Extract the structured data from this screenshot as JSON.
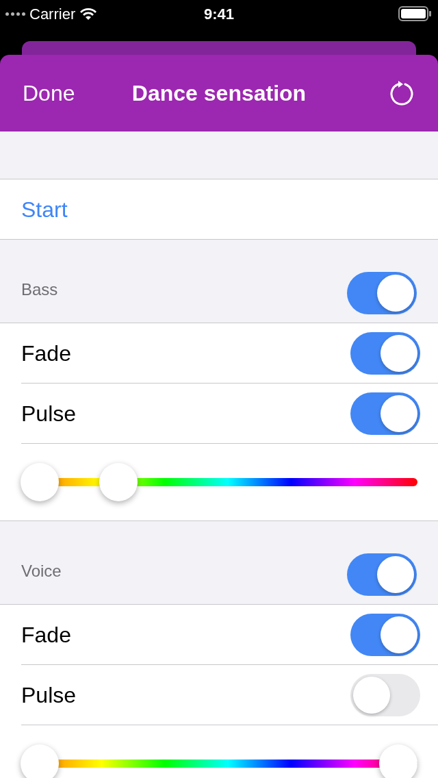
{
  "status_bar": {
    "carrier": "Carrier",
    "time": "9:41"
  },
  "nav": {
    "done": "Done",
    "title": "Dance sensation"
  },
  "start": "Start",
  "sections": [
    {
      "title": "Bass",
      "on": true,
      "rows": [
        {
          "label": "Fade",
          "on": true
        },
        {
          "label": "Pulse",
          "on": true
        }
      ],
      "thumbs": [
        {
          "level": 0
        },
        {
          "level": 0.22
        }
      ]
    },
    {
      "title": "Voice",
      "on": true,
      "rows": [
        {
          "label": "Fade",
          "on": true
        },
        {
          "label": "Pulse",
          "on": false
        }
      ],
      "thumbs": [
        {
          "level": 0
        },
        {
          "level": 1
        }
      ]
    }
  ]
}
